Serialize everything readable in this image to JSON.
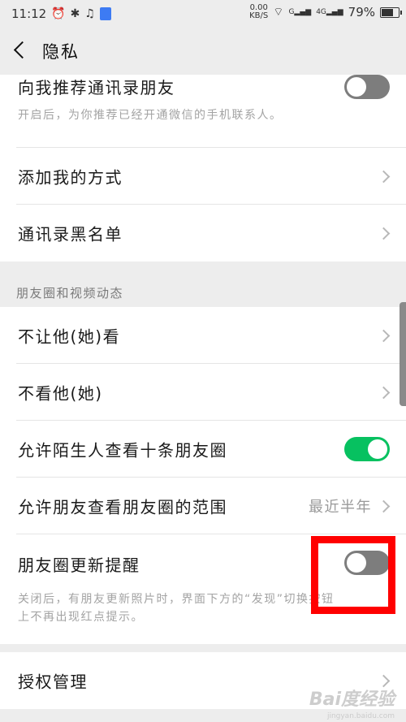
{
  "status_bar": {
    "time": "11:12",
    "net_speed_value": "0.00",
    "net_speed_unit": "KB/S",
    "network_1": "G",
    "network_2": "4G",
    "battery_percent": "79%",
    "battery_level": 0.79
  },
  "header": {
    "title": "隐私"
  },
  "contacts_card": {
    "recommend_label": "向我推荐通讯录朋友",
    "recommend_desc": "开启后，为你推荐已经开通微信的手机联系人。",
    "recommend_on": false,
    "add_me_label": "添加我的方式",
    "blacklist_label": "通讯录黑名单"
  },
  "moments_section": {
    "header": "朋友圈和视频动态",
    "dont_let_see_label": "不让他(她)看",
    "dont_see_label": "不看他(她)",
    "strangers_label": "允许陌生人查看十条朋友圈",
    "strangers_on": true,
    "range_label": "允许朋友查看朋友圈的范围",
    "range_value": "最近半年",
    "update_reminder_label": "朋友圈更新提醒",
    "update_reminder_on": false,
    "update_reminder_desc_1": "关闭后，有朋友更新照片时，界面下方的“发现”切换按钮",
    "update_reminder_desc_2": "上不再出现红点提示。"
  },
  "auth_card": {
    "label": "授权管理"
  },
  "watermark": {
    "logo": "Bai度经验",
    "url": "jingyan.baidu.com"
  },
  "colors": {
    "toggle_on": "#07c160",
    "toggle_off": "#7d7d7d",
    "highlight": "#ff0000"
  },
  "icons": [
    "alarm-icon",
    "bluetooth-icon",
    "qq-icon",
    "shield-icon",
    "wifi-icon",
    "signal-icon",
    "battery-icon",
    "back-arrow-icon",
    "chevron-right-icon"
  ]
}
